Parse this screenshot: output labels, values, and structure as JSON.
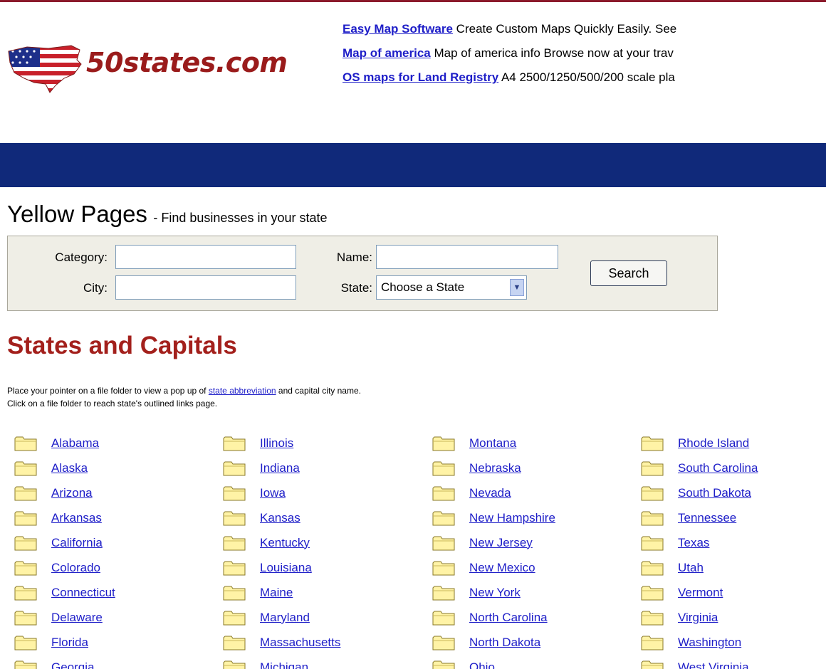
{
  "logo": {
    "text": "50states.com"
  },
  "ads": [
    {
      "link": "Easy Map Software",
      "text": " Create Custom Maps Quickly Easily. See"
    },
    {
      "link": "Map of america",
      "text": " Map of america info Browse now at your trav"
    },
    {
      "link": "OS maps for Land Registry",
      "text": " A4 2500/1250/500/200 scale pla"
    }
  ],
  "yellow_pages": {
    "title": "Yellow Pages",
    "subtitle": "- Find businesses in your state",
    "category_label": "Category:",
    "name_label": "Name:",
    "city_label": "City:",
    "state_label": "State:",
    "state_select": "Choose a State",
    "search_button": "Search",
    "category_value": "",
    "name_value": "",
    "city_value": ""
  },
  "states_section": {
    "title": "States and Capitals",
    "instr1_pre": "Place your pointer on a file folder to view a pop up of ",
    "instr1_link": "state abbreviation",
    "instr1_post": " and capital city name.",
    "instr2": "Click on a file folder to reach state's outlined links page."
  },
  "states_columns": [
    [
      "Alabama",
      "Alaska",
      "Arizona",
      "Arkansas",
      "California",
      "Colorado",
      "Connecticut",
      "Delaware",
      "Florida",
      "Georgia"
    ],
    [
      "Illinois",
      "Indiana",
      "Iowa",
      "Kansas",
      "Kentucky",
      "Louisiana",
      "Maine",
      "Maryland",
      "Massachusetts",
      "Michigan"
    ],
    [
      "Montana",
      "Nebraska",
      "Nevada",
      "New Hampshire",
      "New Jersey",
      "New Mexico",
      "New York",
      "North Carolina",
      "North Dakota",
      "Ohio"
    ],
    [
      "Rhode Island",
      "South Carolina",
      "South Dakota",
      "Tennessee",
      "Texas",
      "Utah",
      "Vermont",
      "Virginia",
      "Washington",
      "West Virginia"
    ]
  ],
  "colors": {
    "nav_bar": "#10297a",
    "link": "#1e1ec8",
    "heading_red": "#a3201c",
    "logo_red": "#9a1b1b",
    "folder_fill": "#fff3a6",
    "yp_box_bg": "#efeee6"
  },
  "icons": {
    "folder": "folder-icon",
    "flag_map_logo": "us-flag-map-icon",
    "dropdown": "chevron-down-icon"
  }
}
